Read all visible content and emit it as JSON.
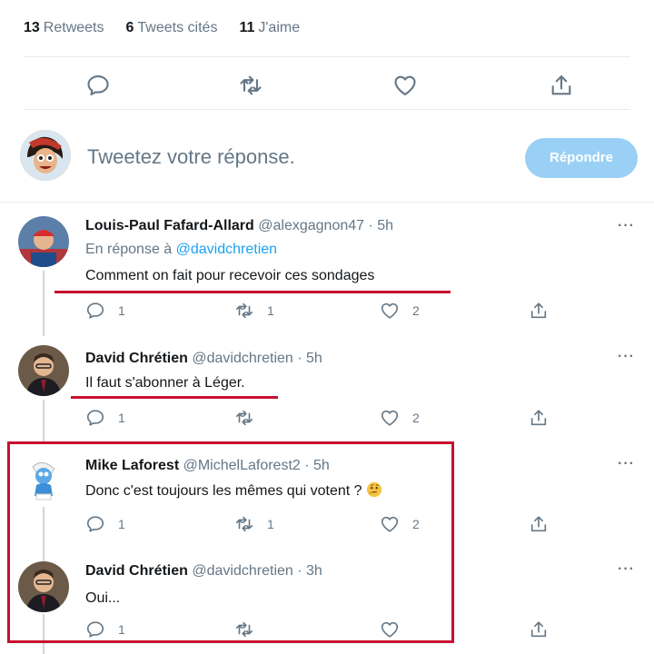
{
  "stats": {
    "retweets_count": "13",
    "retweets_label": "Retweets",
    "quotes_count": "6",
    "quotes_label": "Tweets cités",
    "likes_count": "11",
    "likes_label": "J'aime"
  },
  "reply_box": {
    "placeholder": "Tweetez votre réponse.",
    "button_label": "Répondre"
  },
  "tweets": [
    {
      "name": "Louis-Paul Fafard-Allard",
      "handle": "@alexgagnon47 · 5h",
      "reply_prefix": "En réponse à",
      "reply_mention": "@davidchretien",
      "text": "Comment on fait pour recevoir ces sondages",
      "replies": "1",
      "retweets": "1",
      "likes": "2"
    },
    {
      "name": "David Chrétien",
      "handle": "@davidchretien · 5h",
      "text": "Il faut s'abonner à Léger.",
      "replies": "1",
      "retweets": "",
      "likes": "2"
    },
    {
      "name": "Mike Laforest",
      "handle": "@MichelLaforest2 · 5h",
      "text": "Donc c'est toujours les mêmes qui votent ?",
      "replies": "1",
      "retweets": "1",
      "likes": "2"
    },
    {
      "name": "David Chrétien",
      "handle": "@davidchretien · 3h",
      "text": "Oui...",
      "replies": "1",
      "retweets": "",
      "likes": ""
    }
  ],
  "more_label": "···",
  "colors": {
    "accent": "#1da1f2",
    "highlight": "#c8102e",
    "muted": "#657786"
  },
  "icons": [
    "reply-icon",
    "retweet-icon",
    "like-icon",
    "share-icon",
    "more-icon",
    "thinking-face-icon"
  ]
}
